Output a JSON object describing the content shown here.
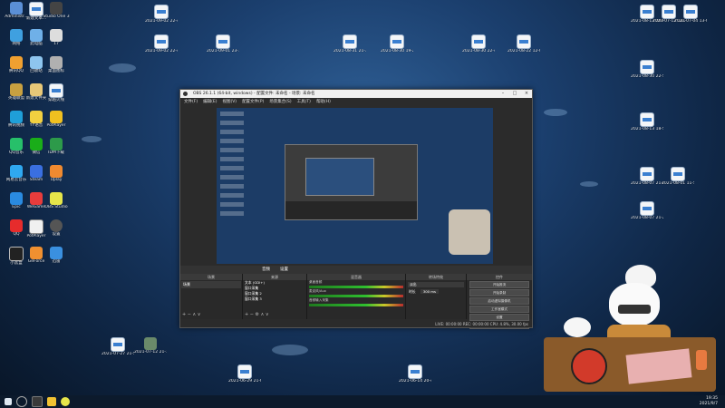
{
  "desktop": {
    "left_icons": [
      {
        "label": "Administr..."
      },
      {
        "label": "新建文本..."
      },
      {
        "label": "Studio One 3"
      },
      {
        "label": "网络"
      },
      {
        "label": "此电脑"
      },
      {
        "label": "17"
      },
      {
        "label": "腾讯QQ"
      },
      {
        "label": "回收站"
      },
      {
        "label": "桌面图标"
      },
      {
        "label": "英雄联盟"
      },
      {
        "label": "新建文件夹"
      },
      {
        "label": "穿越火线"
      },
      {
        "label": "腾讯视频"
      },
      {
        "label": "YY语音"
      },
      {
        "label": "PotPlayer"
      },
      {
        "label": "QQ音乐"
      },
      {
        "label": "微信"
      },
      {
        "label": "IDM下载"
      },
      {
        "label": "网易云音乐"
      },
      {
        "label": "Steam"
      },
      {
        "label": "Uplay"
      },
      {
        "label": "Epic"
      },
      {
        "label": "WeGame"
      },
      {
        "label": "OBS Studio"
      },
      {
        "label": "QQ"
      },
      {
        "label": "PotPlayer"
      },
      {
        "label": "设置"
      },
      {
        "label": "小黑盒"
      },
      {
        "label": "GeForce"
      },
      {
        "label": "迅雷"
      }
    ],
    "top_docs": [
      {
        "label": "2021-09-02 22-40-13..."
      },
      {
        "label": "2021-09-02 22-40-13..."
      },
      {
        "label": "2021-09-01 23-12-14..."
      },
      {
        "label": "2021-08-31 21-36-..."
      },
      {
        "label": "2021-08-30 19-23-45..."
      },
      {
        "label": "2021-08-30 22-41-55..."
      },
      {
        "label": "2021-08-22 12-00-59..."
      },
      {
        "label": "2021-08-13 20-02-52..."
      },
      {
        "label": "2021-07-12 14-24-39..."
      },
      {
        "label": "2021-07-04 13-02-14..."
      }
    ],
    "right_docs": [
      {
        "label": "2021-08-30 22-50-31..."
      },
      {
        "label": "2021-08-13 18-50-34..."
      },
      {
        "label": "2021-08-07 21-09-42..."
      },
      {
        "label": "2021-08-01 11-51-25..."
      },
      {
        "label": "2021-08-07 21-29-42..."
      }
    ],
    "bottom_docs": [
      {
        "label": "2021-07-27 21-51-07..."
      },
      {
        "label": "2021-07-12 21-14-51..."
      },
      {
        "label": "2021-06-29 21-08-21..."
      },
      {
        "label": "2021-06-14 20-41-17..."
      }
    ]
  },
  "obs": {
    "title": "OBS 26.1.1 (64-bit, windows) - 配置文件: 未命名 - 场景: 未命名",
    "menu": [
      "文件(F)",
      "编辑(E)",
      "视图(V)",
      "配置文件(P)",
      "场景集合(S)",
      "工具(T)",
      "帮助(H)"
    ],
    "status_bar": {
      "audio_label": "音频",
      "settings_label": "设置"
    },
    "docks": {
      "scenes": "场景",
      "sources": "来源",
      "mixer": "混音器",
      "transitions": "转场特效",
      "controls": "控件"
    },
    "scenes_list": [
      "场景"
    ],
    "sources_list": [
      "文本 (GDI+)",
      "窗口采集",
      "窗口采集 2",
      "窗口采集 3"
    ],
    "mixer_channels": [
      {
        "name": "桌面音频",
        "level": "0.0 dB"
      },
      {
        "name": "麦克风/Aux",
        "level": "0.0 dB"
      },
      {
        "name": "音频输入采集",
        "level": "0.0 dB"
      }
    ],
    "transition": {
      "type": "淡出",
      "duration_label": "时长",
      "duration": "300 ms"
    },
    "control_buttons": [
      "开始推流",
      "开始录制",
      "启动虚拟摄像机",
      "工作室模式",
      "设置",
      "退出"
    ],
    "status_line": "LIVE: 00:00:00   REC: 00:00:00   CPU: 4.8%, 30.00 fps"
  },
  "taskbar": {
    "time": "19:35",
    "date": "2021/9/7"
  },
  "colors": {
    "accent": "#3a7fd0",
    "obs_bg": "#2b2b2b"
  }
}
